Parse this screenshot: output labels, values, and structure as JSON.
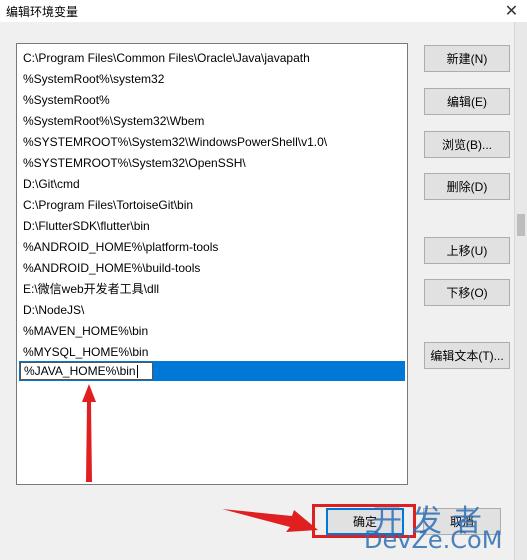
{
  "window": {
    "title": "编辑环境变量",
    "close_glyph": "✕"
  },
  "list": {
    "items": [
      "C:\\Program Files\\Common Files\\Oracle\\Java\\javapath",
      "%SystemRoot%\\system32",
      "%SystemRoot%",
      "%SystemRoot%\\System32\\Wbem",
      "%SYSTEMROOT%\\System32\\WindowsPowerShell\\v1.0\\",
      "%SYSTEMROOT%\\System32\\OpenSSH\\",
      "D:\\Git\\cmd",
      "C:\\Program Files\\TortoiseGit\\bin",
      "D:\\FlutterSDK\\flutter\\bin",
      "%ANDROID_HOME%\\platform-tools",
      "%ANDROID_HOME%\\build-tools",
      "E:\\微信web开发者工具\\dll",
      "D:\\NodeJS\\",
      "%MAVEN_HOME%\\bin",
      "%MYSQL_HOME%\\bin"
    ],
    "editing_value": "%JAVA_HOME%\\bin",
    "selection_color": "#0078d7"
  },
  "buttons": {
    "new": "新建(N)",
    "edit": "编辑(E)",
    "browse": "浏览(B)...",
    "delete": "删除(D)",
    "move_up": "上移(U)",
    "move_down": "下移(O)",
    "edit_text": "编辑文本(T)...",
    "ok": "确定",
    "cancel": "取消"
  },
  "annotation": {
    "color": "#e02020"
  },
  "watermark": {
    "top": "开发者",
    "bottom": "DevZe.CoM"
  }
}
